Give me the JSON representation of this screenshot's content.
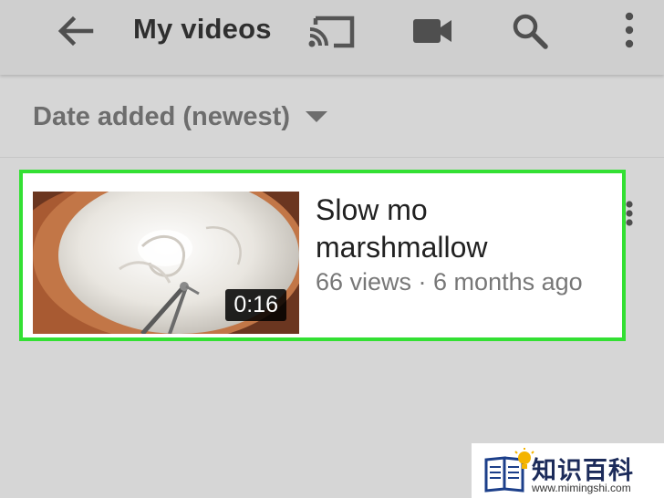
{
  "appbar": {
    "title": "My videos",
    "icons": [
      "arrow-back-icon",
      "cast-icon",
      "video-camera-icon",
      "search-icon",
      "more-vertical-icon"
    ]
  },
  "sort": {
    "label": "Date added (newest)",
    "icon": "dropdown-caret-icon"
  },
  "videos": [
    {
      "title": "Slow mo marshmallow",
      "duration": "0:16",
      "meta": "66 views · 6 months ago"
    }
  ],
  "watermark": {
    "brand": "知识百科",
    "url": "www.mimingshi.com"
  },
  "colors": {
    "appbar": "#cfcfcf",
    "background": "#d6d6d6",
    "highlight": "#33e033",
    "icon": "#4f4f4f"
  }
}
